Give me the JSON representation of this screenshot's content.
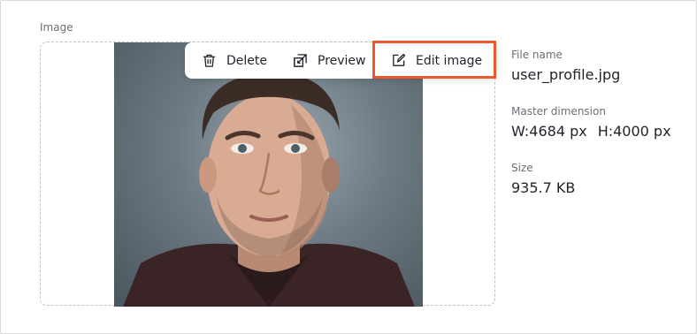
{
  "section": {
    "label": "Image"
  },
  "toolbar": {
    "delete_label": "Delete",
    "preview_label": "Preview",
    "edit_label": "Edit image"
  },
  "details": {
    "file_name_label": "File name",
    "file_name_value": "user_profile.jpg",
    "dimension_label": "Master dimension",
    "width_value": "W:4684 px",
    "height_value": "H:4000 px",
    "size_label": "Size",
    "size_value": "935.7 KB"
  },
  "colors": {
    "highlight": "#ec5a2a",
    "text": "#1f2329",
    "muted": "#6b6f76"
  }
}
